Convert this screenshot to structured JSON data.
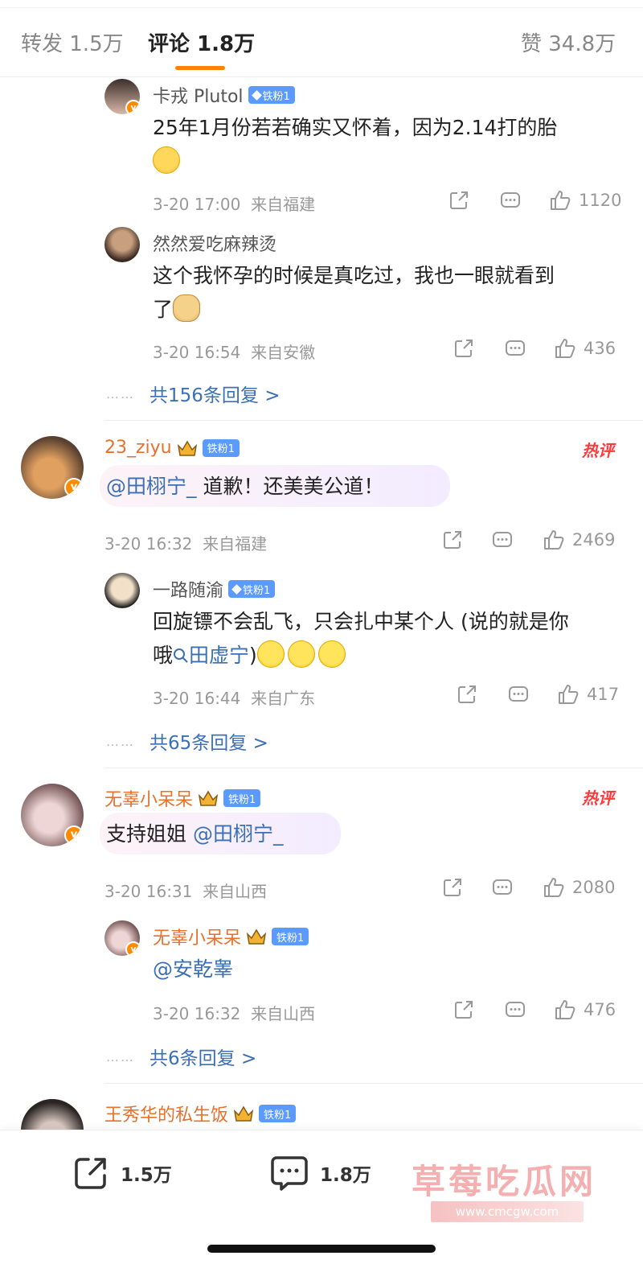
{
  "tabs": {
    "repost": "转发 1.5万",
    "comments": "评论 1.8万",
    "likes": "赞 34.8万"
  },
  "colors": {
    "accent": "#ff8200",
    "link": "#3b6fb6",
    "vip_name": "#e8702a",
    "badge": "#5b9bff",
    "hot": "#ff3a3a"
  },
  "badges": {
    "iron_fan": "铁粉1"
  },
  "hot_label": "热评",
  "thread1": {
    "reply1": {
      "name": "卡戎 Plutol",
      "text": "25年1月份若若确实又怀着，因为2.14打的胎",
      "emoji": "crying-face-icon",
      "time": "3-20 17:00",
      "location": "来自福建",
      "likes": "1120"
    },
    "reply2": {
      "name": "然然爱吃麻辣烫",
      "text_line1": "这个我怀孕的时候是真吃过，我也一眼就看到",
      "text_line2": "了",
      "emoji": "doge-icon",
      "time": "3-20 16:54",
      "location": "来自安徽",
      "likes": "436"
    },
    "more": "共156条回复 >"
  },
  "comment2": {
    "name": "23_ziyu",
    "mention": "@田栩宁_",
    "text": " 道歉！还美美公道！",
    "time": "3-20 16:32",
    "location": "来自福建",
    "likes": "2469",
    "reply": {
      "name": "一路随渝",
      "text_line1": "回旋镖不会乱飞，只会扎中某个人 (说的就是你",
      "text_line2_prefix": "哦",
      "search_link": "田虚宁",
      "text_line2_suffix": ")",
      "time": "3-20 16:44",
      "location": "来自广东",
      "likes": "417"
    },
    "more": "共65条回复 >"
  },
  "comment3": {
    "name": "无辜小呆呆",
    "text": "支持姐姐 ",
    "mention": "@田栩宁_",
    "time": "3-20 16:31",
    "location": "来自山西",
    "likes": "2080",
    "reply": {
      "name": "无辜小呆呆",
      "mention": "@安乾睾",
      "time": "3-20 16:32",
      "location": "来自山西",
      "likes": "476"
    },
    "more": "共6条回复 >"
  },
  "comment4": {
    "name": "王秀华的私生饭"
  },
  "bottom_bar": {
    "repost_count": "1.5万",
    "comment_count": "1.8万",
    "watermark": "草莓吃瓜网",
    "watermark_url": "www.cmcgw.com"
  }
}
